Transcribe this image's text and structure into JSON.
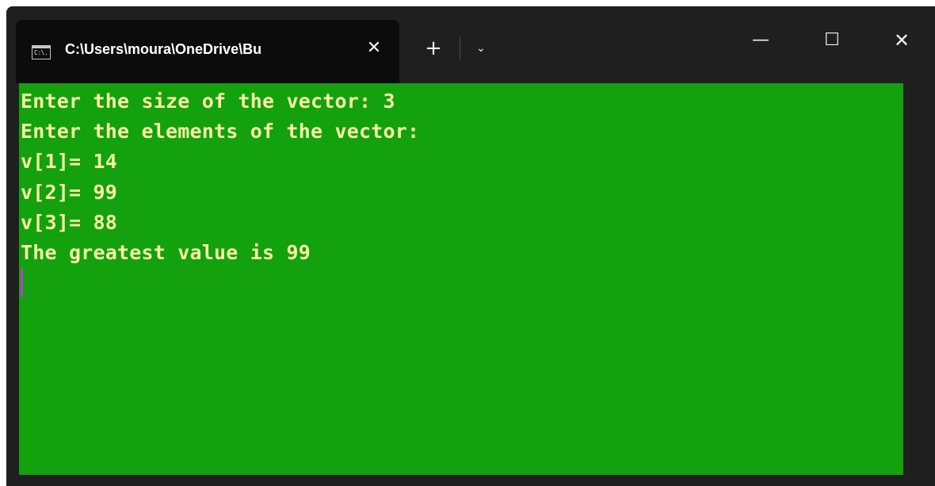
{
  "tab": {
    "icon_label": "C:\\.",
    "title": "C:\\Users\\moura\\OneDrive\\Bu"
  },
  "controls": {
    "tab_close": "✕",
    "new_tab": "+",
    "dropdown": "⌄",
    "minimize": "—",
    "maximize": "☐",
    "close": "✕"
  },
  "console": {
    "lines": [
      "Enter the size of the vector: 3",
      "Enter the elements of the vector:",
      "v[1]= 14",
      "v[2]= 99",
      "v[3]= 88",
      "The greatest value is 99"
    ]
  },
  "colors": {
    "console_background": "#13a10e",
    "console_text": "#f9f1a5",
    "cursor": "#b040d0",
    "titlebar": "#1f1f1f"
  }
}
